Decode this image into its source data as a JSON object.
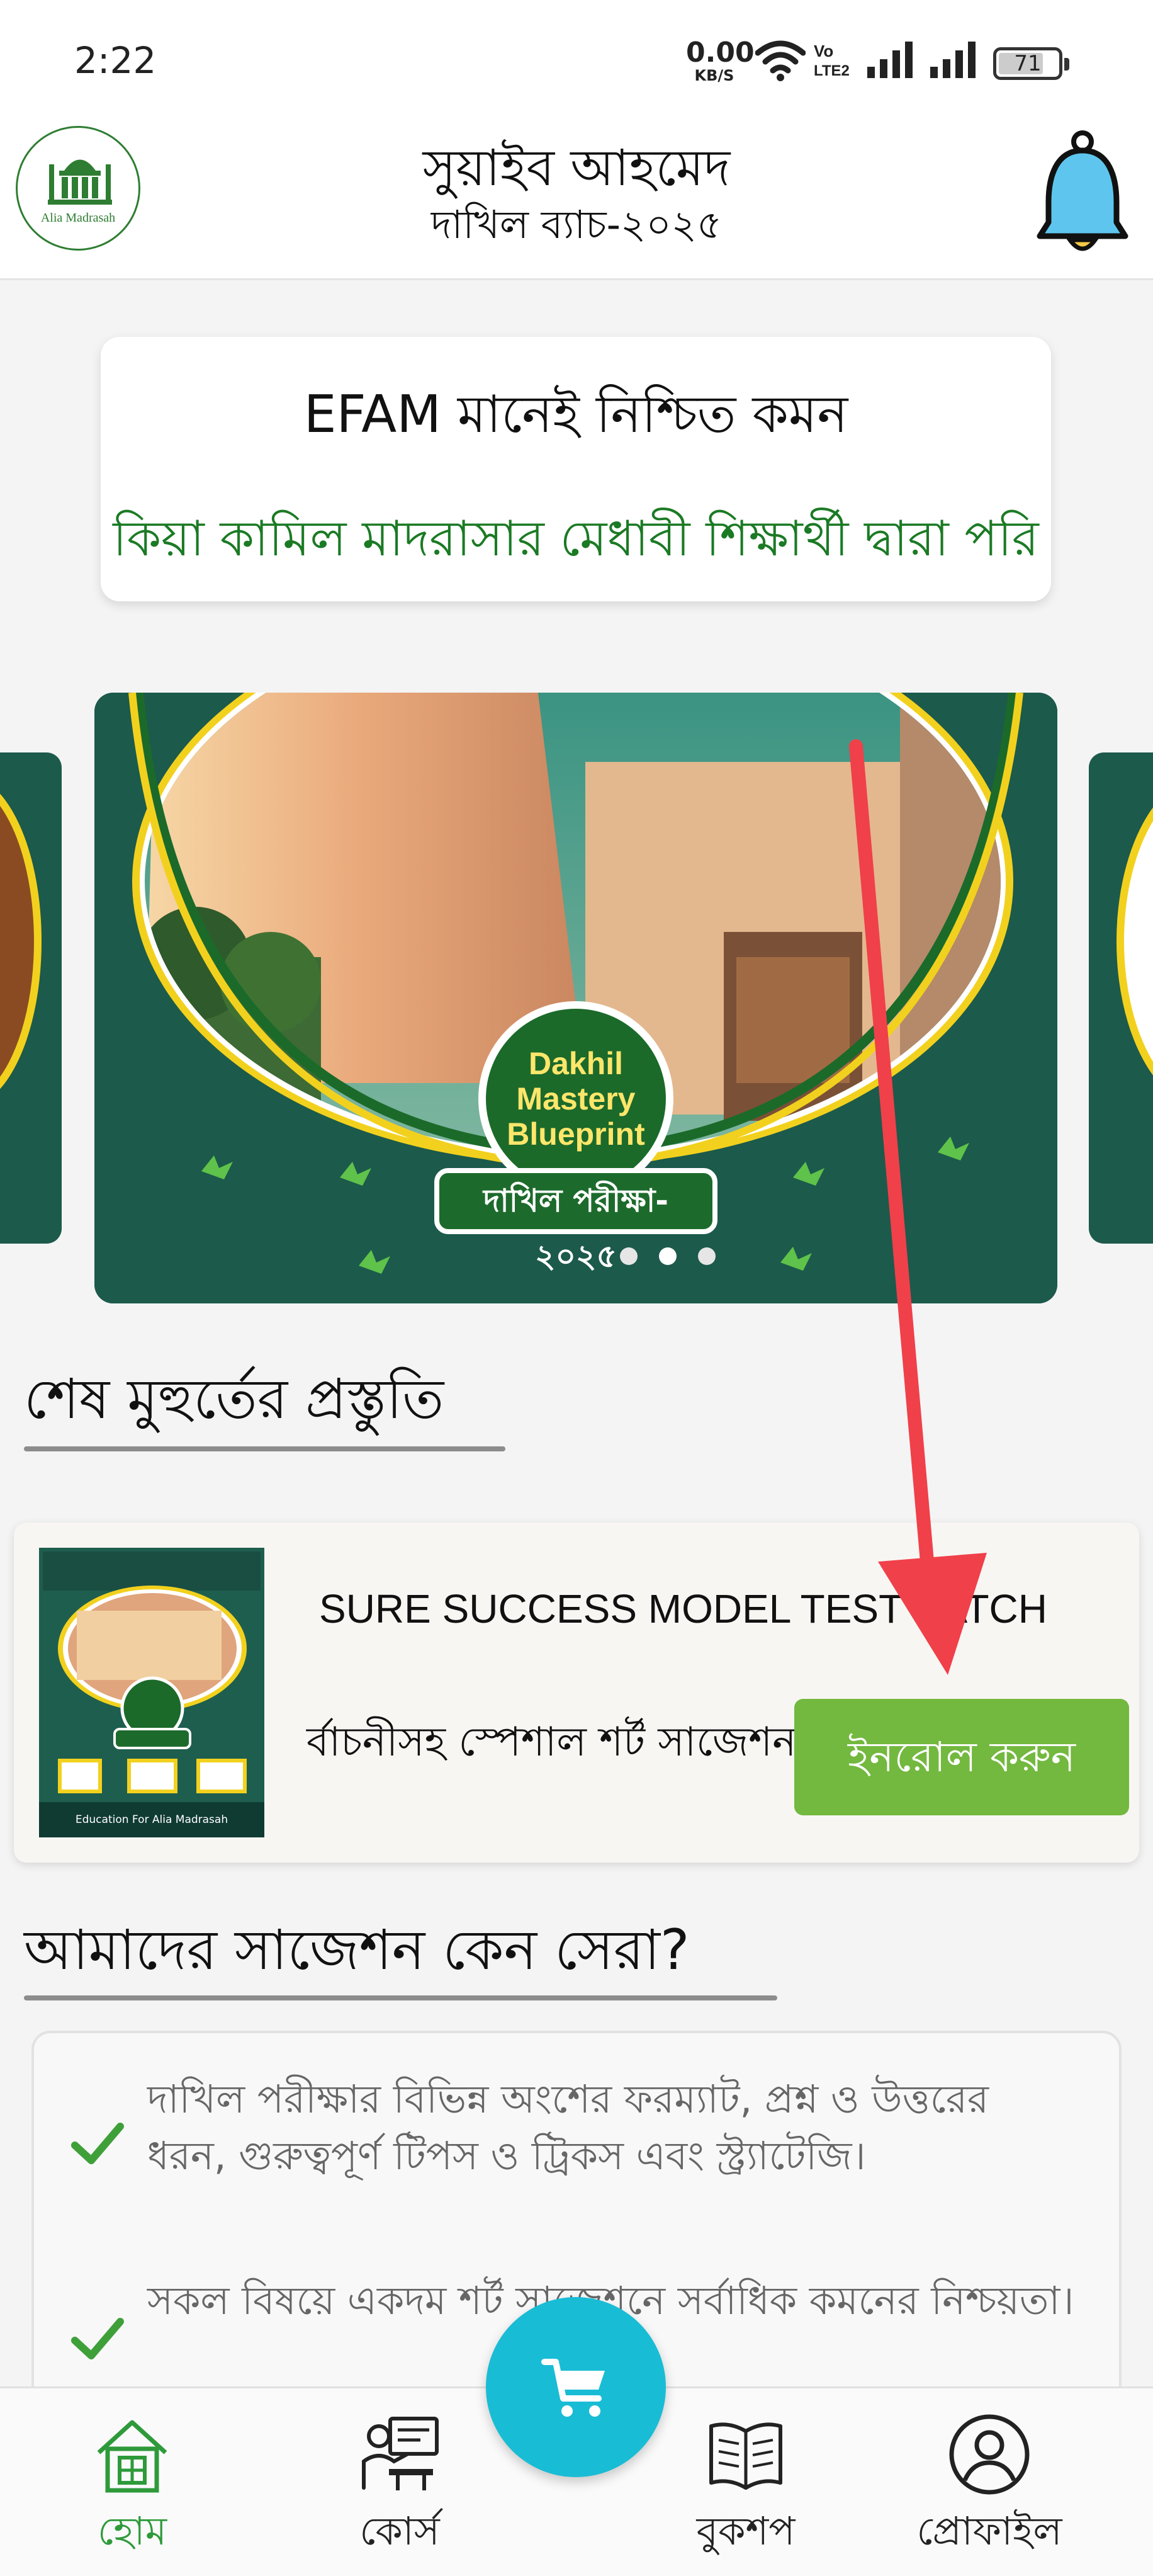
{
  "status_bar": {
    "time": "2:22",
    "net_speed_value": "0.00",
    "net_speed_unit": "KB/S",
    "battery_level": "71",
    "icons": [
      "wifi-icon",
      "volte-icon",
      "signal-icon",
      "signal-icon-2",
      "battery-icon"
    ]
  },
  "header": {
    "user_name": "সুয়াইব আহমেদ",
    "batch": "দাখিল ব্যাচ-২০২৫",
    "logo_text": "Alia Madrasah",
    "notification_icon": "bell-icon"
  },
  "promo": {
    "title": "EFAM মানেই নিশ্চিত কমন",
    "subtitle": "কিয়া কামিল মাদরাসার মেধাবী শিক্ষার্থী দ্বারা পরি"
  },
  "carousel": {
    "seal_lines": [
      "Dakhil",
      "Mastery",
      "Blueprint"
    ],
    "ribbon": "দাখিল পরীক্ষা- ২০২৫",
    "slide_count": 3,
    "active_index": 1
  },
  "sections": {
    "last_minute": "শেষ মুহুর্তের প্রস্তুতি",
    "why_best": "আমাদের সাজেশন কেন সেরা?"
  },
  "course": {
    "title": "SURE SUCCESS MODEL TEST BATCH",
    "description": "র্বাচনীসহ স্পেশাল শর্ট সাজেশন",
    "enroll_label": "ইনরোল করুন",
    "thumb_footer": "Education For Alia Madrasah"
  },
  "reasons": [
    "দাখিল পরীক্ষার বিভিন্ন অংশের ফরম্যাট, প্রশ্ন ও উত্তরের ধরন, গুরুত্বপূর্ণ টিপস ও ট্রিকস এবং স্ট্র্যাটেজি।",
    "সকল বিষয়ে একদম শর্ট সাজেশনে সর্বাধিক কমনের নিশ্চয়তা।"
  ],
  "bottom_nav": {
    "items": [
      {
        "label": "হোম",
        "icon": "home-icon",
        "active": true
      },
      {
        "label": "কোর্স",
        "icon": "course-icon",
        "active": false
      },
      {
        "label": "বুকশপ",
        "icon": "book-icon",
        "active": false
      },
      {
        "label": "প্রোফাইল",
        "icon": "profile-icon",
        "active": false
      }
    ],
    "cart_icon": "cart-icon"
  },
  "colors": {
    "accent_green": "#73b83f",
    "text_green": "#1b7a24",
    "nav_active": "#2e9a3a",
    "cart_fab": "#19bcd5",
    "annotation_arrow": "#f0404a"
  }
}
